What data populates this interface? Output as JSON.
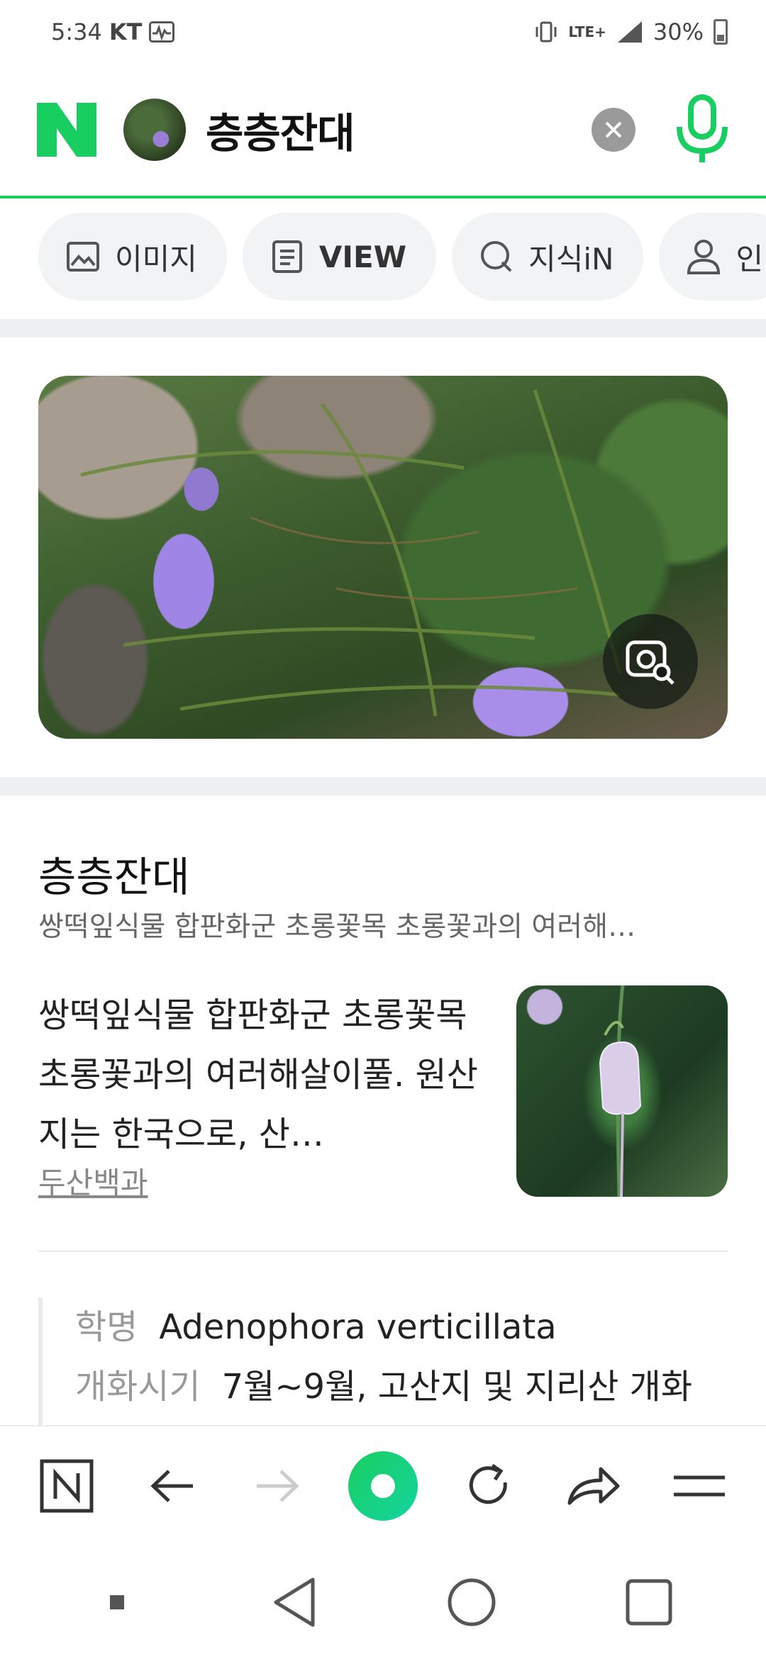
{
  "status_bar": {
    "time": "5:34",
    "carrier": "KT",
    "network": "LTE+",
    "battery": "30%"
  },
  "search": {
    "query": "층층잔대",
    "logo": "N"
  },
  "tabs": [
    {
      "label": "이미지",
      "icon": "image-icon"
    },
    {
      "label": "VIEW",
      "icon": "document-icon"
    },
    {
      "label": "지식iN",
      "icon": "q-icon"
    },
    {
      "label": "인",
      "icon": "person-icon"
    }
  ],
  "knowledge_panel": {
    "title": "층층잔대",
    "subtitle": "쌍떡잎식물 합판화군 초롱꽃목 초롱꽃과의 여러해…",
    "description": "쌍떡잎식물 합판화군 초롱꽃목 초롱꽃과의 여러해살이풀. 원산지는 한국으로, 산…",
    "source": "두산백과",
    "info": [
      {
        "key": "학명",
        "value": "Adenophora verticillata"
      },
      {
        "key": "개화시기",
        "value": "7월~9월, 고산지 및 지리산 개화"
      }
    ]
  },
  "colors": {
    "accent": "#19ce60",
    "tab_bg": "#f2f3f5"
  }
}
